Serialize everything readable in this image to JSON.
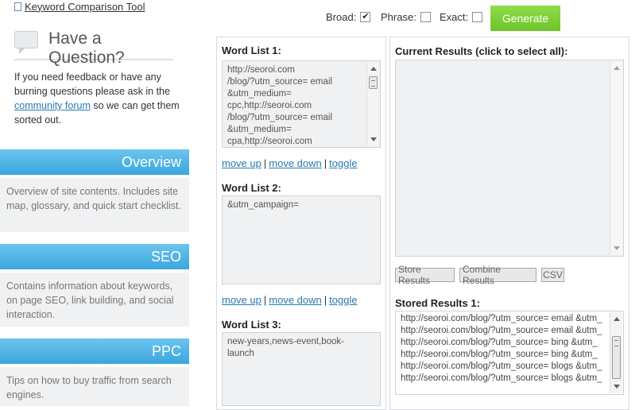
{
  "sidebar": {
    "top_link": "Keyword Comparison Tool",
    "question": {
      "title": "Have a Question?",
      "text_before": "If you need feedback or have any burning questions please ask in the ",
      "link": "community forum",
      "text_after": " so we can get them sorted out."
    },
    "sections": [
      {
        "title": "Overview",
        "description": "Overview of site contents. Includes site map, glossary, and quick start checklist."
      },
      {
        "title": "SEO",
        "description": "Contains information about keywords, on page SEO, link building, and social interaction."
      },
      {
        "title": "PPC",
        "description": "Tips on how to buy traffic from search engines."
      }
    ]
  },
  "options": {
    "broad": {
      "label": "Broad:",
      "checked": true
    },
    "phrase": {
      "label": "Phrase:",
      "checked": false
    },
    "exact": {
      "label": "Exact:",
      "checked": false
    },
    "generate_label": "Generate"
  },
  "word_lists": [
    {
      "title": "Word List 1:",
      "value": "http://seoroi.com\n/blog/?utm_source= email\n&utm_medium=\ncpc,http://seoroi.com\n/blog/?utm_source= email\n&utm_medium=\ncpa,http://seoroi.com"
    },
    {
      "title": "Word List 2:",
      "value": "&utm_campaign="
    },
    {
      "title": "Word List 3:",
      "value": "new-years,news-event,book-\nlaunch"
    }
  ],
  "list_actions": {
    "move_up": "move up",
    "move_down": "move down",
    "toggle": "toggle",
    "separator": "|"
  },
  "results": {
    "current_title": "Current Results (click to select all):",
    "buttons": {
      "store": "Store Results",
      "combine": "Combine Results",
      "csv": "CSV"
    },
    "stored_title": "Stored Results 1:",
    "stored_lines": [
      "http://seoroi.com/blog/?utm_source= email &utm_",
      "http://seoroi.com/blog/?utm_source= email &utm_",
      "http://seoroi.com/blog/?utm_source= bing &utm_",
      "http://seoroi.com/blog/?utm_source= bing &utm_",
      "http://seoroi.com/blog/?utm_source= blogs &utm_",
      "http://seoroi.com/blog/?utm_source= blogs &utm_"
    ]
  },
  "colors": {
    "accent_blue": "#3aa6df",
    "generate_green": "#6cc428",
    "link_blue": "#2a7ab0"
  }
}
